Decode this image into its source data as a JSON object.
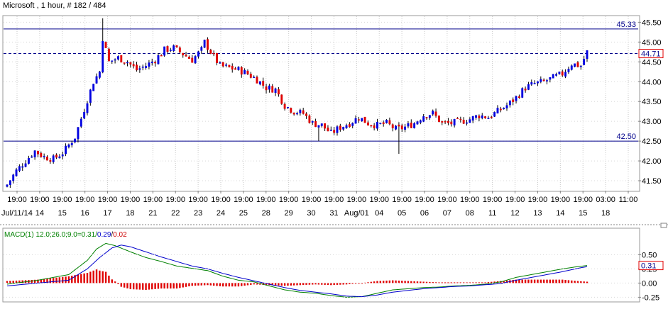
{
  "chart_data": [
    {
      "type": "candlestick",
      "title": "Microsoft , 1 hour, # 182 / 484",
      "ylim": [
        41.25,
        45.65
      ],
      "y_ticks": [
        "41.50",
        "42.00",
        "42.50",
        "43.00",
        "43.50",
        "44.00",
        "44.50",
        "45.00",
        "45.50"
      ],
      "x_ticks": [
        {
          "time": "19:00",
          "date": "Jul/11/14"
        },
        {
          "time": "19:00",
          "date": "14"
        },
        {
          "time": "19:00",
          "date": "15"
        },
        {
          "time": "19:00",
          "date": "16"
        },
        {
          "time": "19:00",
          "date": "17"
        },
        {
          "time": "19:00",
          "date": "18"
        },
        {
          "time": "19:00",
          "date": "21"
        },
        {
          "time": "19:00",
          "date": "22"
        },
        {
          "time": "19:00",
          "date": "23"
        },
        {
          "time": "19:00",
          "date": "24"
        },
        {
          "time": "19:00",
          "date": "25"
        },
        {
          "time": "19:00",
          "date": "28"
        },
        {
          "time": "19:00",
          "date": "29"
        },
        {
          "time": "19:00",
          "date": "30"
        },
        {
          "time": "19:00",
          "date": "31"
        },
        {
          "time": "19:00",
          "date": "Aug/01"
        },
        {
          "time": "19:00",
          "date": "04"
        },
        {
          "time": "19:00",
          "date": "05"
        },
        {
          "time": "19:00",
          "date": "06"
        },
        {
          "time": "19:00",
          "date": "07"
        },
        {
          "time": "19:00",
          "date": "08"
        },
        {
          "time": "19:00",
          "date": "11"
        },
        {
          "time": "19:00",
          "date": "12"
        },
        {
          "time": "19:00",
          "date": "13"
        },
        {
          "time": "19:00",
          "date": "14"
        },
        {
          "time": "19:00",
          "date": "15"
        },
        {
          "time": "03:00",
          "date": "18"
        },
        {
          "time": "11:00",
          "date": ""
        }
      ],
      "hlines": [
        {
          "value": 45.33,
          "label": "45.33",
          "style": "solid",
          "color": "#00008b"
        },
        {
          "value": 44.71,
          "label": "44.71",
          "style": "dashed",
          "color": "#00008b"
        },
        {
          "value": 42.5,
          "label": "42.50",
          "style": "solid",
          "color": "#00008b"
        }
      ],
      "last_price_label": "44.71",
      "up_color": "#0000e0",
      "down_color": "#e00000",
      "anchor_closes": [
        [
          0,
          41.4
        ],
        [
          3,
          41.75
        ],
        [
          6,
          42.0
        ],
        [
          9,
          42.25
        ],
        [
          12,
          42.1
        ],
        [
          15,
          42.05
        ],
        [
          18,
          42.2
        ],
        [
          22,
          42.6
        ],
        [
          25,
          43.3
        ],
        [
          28,
          44.0
        ],
        [
          30,
          44.25
        ],
        [
          31,
          45.1
        ],
        [
          33,
          44.5
        ],
        [
          36,
          44.6
        ],
        [
          39,
          44.5
        ],
        [
          42,
          44.3
        ],
        [
          45,
          44.4
        ],
        [
          48,
          44.55
        ],
        [
          51,
          44.8
        ],
        [
          54,
          44.85
        ],
        [
          57,
          44.7
        ],
        [
          60,
          44.55
        ],
        [
          63,
          44.8
        ],
        [
          64,
          45.0
        ],
        [
          66,
          44.75
        ],
        [
          69,
          44.4
        ],
        [
          72,
          44.35
        ],
        [
          75,
          44.3
        ],
        [
          78,
          44.2
        ],
        [
          81,
          44.05
        ],
        [
          84,
          43.85
        ],
        [
          87,
          43.8
        ],
        [
          90,
          43.4
        ],
        [
          93,
          43.25
        ],
        [
          96,
          43.2
        ],
        [
          99,
          42.95
        ],
        [
          102,
          42.9
        ],
        [
          105,
          42.7
        ],
        [
          108,
          42.85
        ],
        [
          111,
          42.95
        ],
        [
          114,
          43.1
        ],
        [
          117,
          42.95
        ],
        [
          120,
          42.9
        ],
        [
          123,
          42.95
        ],
        [
          126,
          42.8
        ],
        [
          129,
          42.85
        ],
        [
          132,
          42.95
        ],
        [
          135,
          43.15
        ],
        [
          138,
          43.2
        ],
        [
          141,
          42.95
        ],
        [
          144,
          42.95
        ],
        [
          147,
          43.0
        ],
        [
          150,
          43.05
        ],
        [
          153,
          43.15
        ],
        [
          156,
          43.1
        ],
        [
          159,
          43.25
        ],
        [
          162,
          43.4
        ],
        [
          165,
          43.6
        ],
        [
          168,
          43.85
        ],
        [
          171,
          43.95
        ],
        [
          174,
          44.0
        ],
        [
          177,
          44.1
        ],
        [
          180,
          44.2
        ],
        [
          183,
          44.45
        ],
        [
          186,
          44.4
        ],
        [
          188,
          44.75
        ]
      ],
      "n_bars": 189
    },
    {
      "type": "macd",
      "title": "MACD(1) 12.0;26.0;9.0=0.31/0.29/0.02",
      "title_parts": [
        "MACD(1) 12.0;26.0;9.0=0.31/",
        "0.29",
        "/",
        "0.02"
      ],
      "ylim": [
        -0.32,
        0.78
      ],
      "y_ticks": [
        "0.50",
        "0.25",
        "0.00",
        "-0.25"
      ],
      "last_value_label": "0.31",
      "macd_color": "#008000",
      "signal_color": "#0000cc",
      "hist_color": "#e00000",
      "macd_anchors": [
        [
          0,
          -0.02
        ],
        [
          10,
          0.05
        ],
        [
          20,
          0.15
        ],
        [
          26,
          0.4
        ],
        [
          29,
          0.6
        ],
        [
          32,
          0.7
        ],
        [
          35,
          0.66
        ],
        [
          40,
          0.55
        ],
        [
          45,
          0.45
        ],
        [
          50,
          0.38
        ],
        [
          55,
          0.3
        ],
        [
          60,
          0.26
        ],
        [
          65,
          0.22
        ],
        [
          70,
          0.12
        ],
        [
          75,
          0.05
        ],
        [
          80,
          0.02
        ],
        [
          85,
          -0.05
        ],
        [
          90,
          -0.12
        ],
        [
          95,
          -0.16
        ],
        [
          100,
          -0.18
        ],
        [
          105,
          -0.22
        ],
        [
          110,
          -0.25
        ],
        [
          115,
          -0.24
        ],
        [
          120,
          -0.18
        ],
        [
          125,
          -0.12
        ],
        [
          130,
          -0.1
        ],
        [
          135,
          -0.08
        ],
        [
          140,
          -0.07
        ],
        [
          145,
          -0.05
        ],
        [
          150,
          -0.04
        ],
        [
          155,
          -0.02
        ],
        [
          160,
          0.02
        ],
        [
          165,
          0.1
        ],
        [
          170,
          0.15
        ],
        [
          175,
          0.2
        ],
        [
          180,
          0.25
        ],
        [
          185,
          0.29
        ],
        [
          188,
          0.31
        ]
      ],
      "signal_anchors": [
        [
          0,
          -0.05
        ],
        [
          10,
          0.0
        ],
        [
          20,
          0.05
        ],
        [
          26,
          0.25
        ],
        [
          30,
          0.45
        ],
        [
          34,
          0.62
        ],
        [
          37,
          0.67
        ],
        [
          40,
          0.64
        ],
        [
          45,
          0.55
        ],
        [
          50,
          0.46
        ],
        [
          55,
          0.38
        ],
        [
          60,
          0.3
        ],
        [
          65,
          0.25
        ],
        [
          70,
          0.17
        ],
        [
          75,
          0.1
        ],
        [
          80,
          0.04
        ],
        [
          85,
          -0.02
        ],
        [
          90,
          -0.08
        ],
        [
          95,
          -0.13
        ],
        [
          100,
          -0.16
        ],
        [
          105,
          -0.19
        ],
        [
          110,
          -0.23
        ],
        [
          115,
          -0.24
        ],
        [
          120,
          -0.21
        ],
        [
          125,
          -0.16
        ],
        [
          130,
          -0.13
        ],
        [
          135,
          -0.1
        ],
        [
          140,
          -0.08
        ],
        [
          145,
          -0.06
        ],
        [
          150,
          -0.05
        ],
        [
          155,
          -0.03
        ],
        [
          160,
          -0.01
        ],
        [
          165,
          0.05
        ],
        [
          170,
          0.1
        ],
        [
          175,
          0.15
        ],
        [
          180,
          0.2
        ],
        [
          185,
          0.26
        ],
        [
          188,
          0.29
        ]
      ]
    }
  ]
}
